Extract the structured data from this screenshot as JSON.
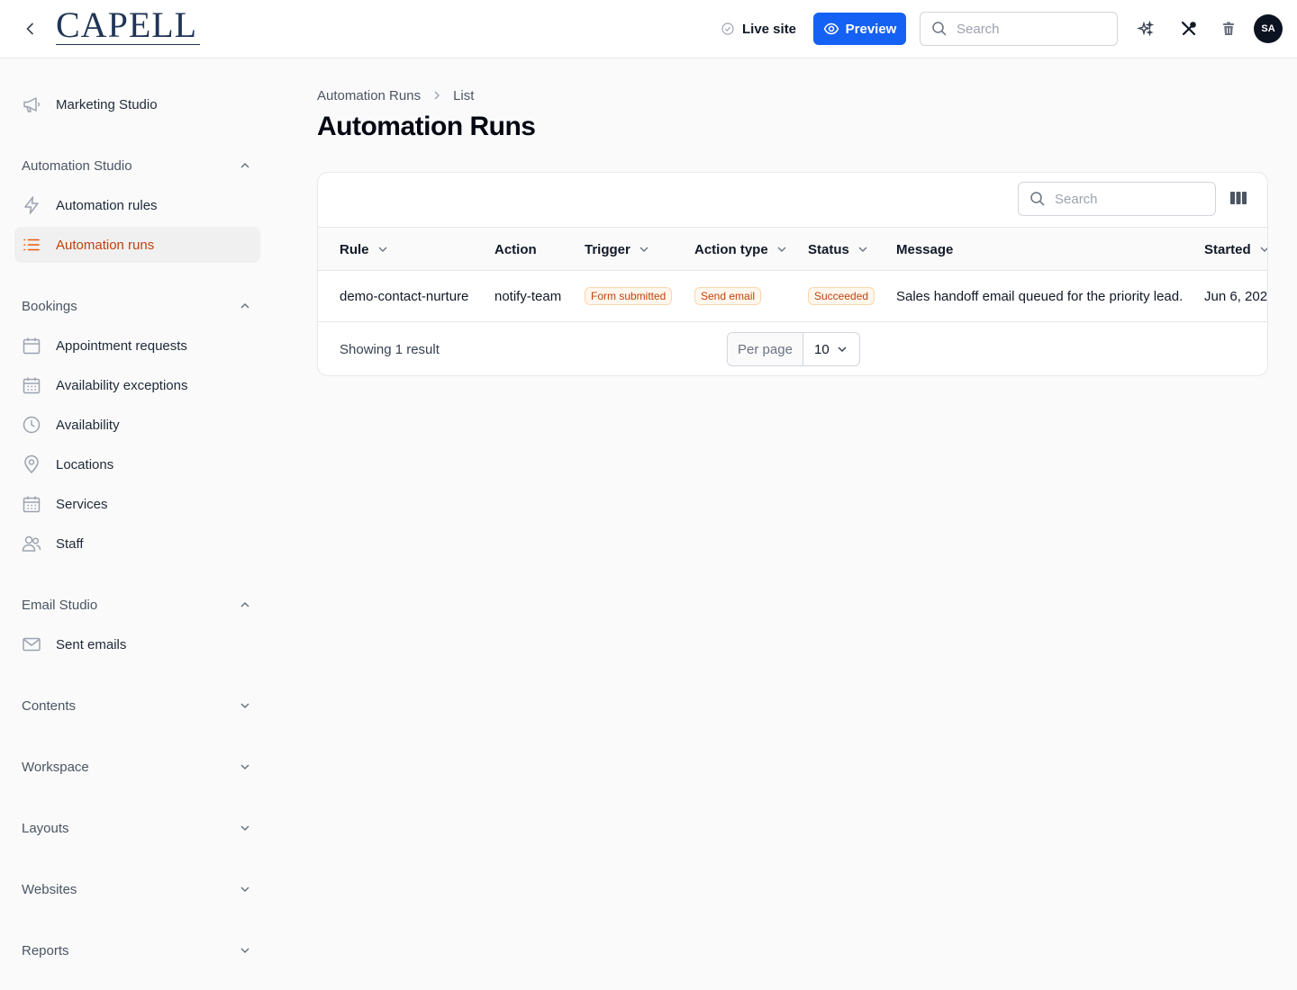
{
  "topbar": {
    "logo_text": "CAPELL",
    "live_site_label": "Live site",
    "preview_label": "Preview",
    "search_placeholder": "Search",
    "avatar_initials": "SA",
    "icons": [
      "chevron-left-icon",
      "check-circle-icon",
      "eye-icon",
      "search-icon",
      "sparkles-icon",
      "tools-icon",
      "trash-icon"
    ]
  },
  "sidebar": {
    "top_item": {
      "label": "Marketing Studio",
      "icon": "megaphone-icon"
    },
    "groups": [
      {
        "label": "Automation Studio",
        "expanded": true,
        "items": [
          {
            "label": "Automation rules",
            "icon": "bolt-icon"
          },
          {
            "label": "Automation runs",
            "icon": "list-icon",
            "active": true
          }
        ]
      },
      {
        "label": "Bookings",
        "expanded": true,
        "items": [
          {
            "label": "Appointment requests",
            "icon": "calendar-icon"
          },
          {
            "label": "Availability exceptions",
            "icon": "calendar-grid-icon"
          },
          {
            "label": "Availability",
            "icon": "clock-icon"
          },
          {
            "label": "Locations",
            "icon": "map-pin-icon"
          },
          {
            "label": "Services",
            "icon": "calendar-grid-icon"
          },
          {
            "label": "Staff",
            "icon": "users-icon"
          }
        ]
      },
      {
        "label": "Email Studio",
        "expanded": true,
        "items": [
          {
            "label": "Sent emails",
            "icon": "envelope-icon"
          }
        ]
      },
      {
        "label": "Contents",
        "expanded": false,
        "items": []
      },
      {
        "label": "Workspace",
        "expanded": false,
        "items": []
      },
      {
        "label": "Layouts",
        "expanded": false,
        "items": []
      },
      {
        "label": "Websites",
        "expanded": false,
        "items": []
      },
      {
        "label": "Reports",
        "expanded": false,
        "items": []
      }
    ]
  },
  "main": {
    "breadcrumb": [
      "Automation Runs",
      "List"
    ],
    "title": "Automation Runs",
    "table": {
      "search_placeholder": "Search",
      "columns": [
        {
          "label": "Rule",
          "sortable": true
        },
        {
          "label": "Action",
          "sortable": false
        },
        {
          "label": "Trigger",
          "sortable": true
        },
        {
          "label": "Action type",
          "sortable": true
        },
        {
          "label": "Status",
          "sortable": true
        },
        {
          "label": "Message",
          "sortable": false
        },
        {
          "label": "Started",
          "sortable": true
        }
      ],
      "rows": [
        {
          "rule": "demo-contact-nurture",
          "action": "notify-team",
          "trigger": "Form submitted",
          "action_type": "Send email",
          "status": "Succeeded",
          "message": "Sales handoff email queued for the priority lead.",
          "started": "Jun 6, 202"
        }
      ],
      "showing": "Showing 1 result",
      "per_page_label": "Per page",
      "per_page_value": "10"
    }
  },
  "colors": {
    "accent": "#1461f4",
    "active_nav": "#c2410c",
    "badge_text": "#c2410c",
    "badge_bg": "#fff7ed",
    "logo": "#1f3556"
  }
}
